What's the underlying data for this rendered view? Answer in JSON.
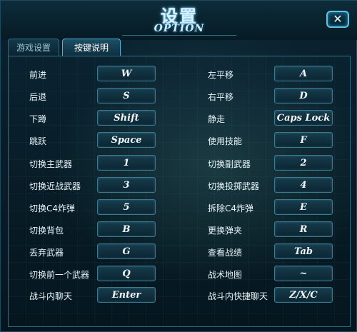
{
  "title": {
    "cn": "设置",
    "en": "OPTION"
  },
  "close_label": "✕",
  "tabs": [
    {
      "label": "游戏设置",
      "active": false
    },
    {
      "label": "按键说明",
      "active": true
    }
  ],
  "left_column": [
    {
      "action": "前进",
      "key": "W"
    },
    {
      "action": "后退",
      "key": "S"
    },
    {
      "action": "下蹲",
      "key": "Shift"
    },
    {
      "action": "跳跃",
      "key": "Space"
    },
    {
      "action": "切换主武器",
      "key": "1"
    },
    {
      "action": "切换近战武器",
      "key": "3"
    },
    {
      "action": "切换C4炸弹",
      "key": "5"
    },
    {
      "action": "切换背包",
      "key": "B"
    },
    {
      "action": "丢弃武器",
      "key": "G"
    },
    {
      "action": "切换前一个武器",
      "key": "Q"
    },
    {
      "action": "战斗内聊天",
      "key": "Enter"
    }
  ],
  "right_column": [
    {
      "action": "左平移",
      "key": "A"
    },
    {
      "action": "右平移",
      "key": "D"
    },
    {
      "action": "静走",
      "key": "Caps Lock"
    },
    {
      "action": "使用技能",
      "key": "F"
    },
    {
      "action": "切换副武器",
      "key": "2"
    },
    {
      "action": "切换投掷武器",
      "key": "4"
    },
    {
      "action": "拆除C4炸弹",
      "key": "E"
    },
    {
      "action": "更换弹夹",
      "key": "R"
    },
    {
      "action": "查看战绩",
      "key": "Tab"
    },
    {
      "action": "战术地图",
      "key": "~"
    },
    {
      "action": "战斗内快捷聊天",
      "key": "Z/X/C"
    }
  ]
}
